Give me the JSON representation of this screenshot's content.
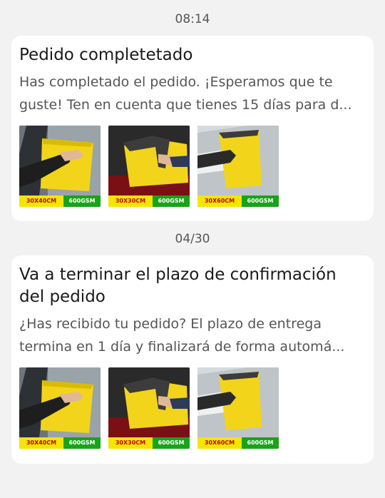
{
  "notifications": [
    {
      "time": "08:14",
      "title": "Pedido completetado",
      "body": "Has completado el pedido. ¡Esperamos que te guste! Ten en cuenta que tienes 15 días para d...",
      "thumbnails": [
        {
          "size_label": "30X40CM",
          "gsm_label": "600GSM",
          "variant": "hand-yellow"
        },
        {
          "size_label": "30X30CM",
          "gsm_label": "600GSM",
          "variant": "towel-dark"
        },
        {
          "size_label": "30X60CM",
          "gsm_label": "600GSM",
          "variant": "car-window"
        }
      ]
    },
    {
      "time": "04/30",
      "title": "Va a terminar el plazo de confirmación del pedido",
      "body": "¿Has recibido tu pedido? El plazo de entrega termina en 1 día y finalizará de forma automá...",
      "thumbnails": [
        {
          "size_label": "30X40CM",
          "gsm_label": "600GSM",
          "variant": "hand-yellow"
        },
        {
          "size_label": "30X30CM",
          "gsm_label": "600GSM",
          "variant": "towel-dark"
        },
        {
          "size_label": "30X60CM",
          "gsm_label": "600GSM",
          "variant": "car-window"
        }
      ]
    }
  ],
  "colors": {
    "background": "#f2f2f2",
    "card": "#ffffff",
    "towel_yellow": "#f2d51a",
    "towel_gray": "#3c3c3c",
    "size_tag_bg": "#f3e600",
    "size_tag_text": "#c40000",
    "gsm_tag_bg": "#18a418"
  }
}
